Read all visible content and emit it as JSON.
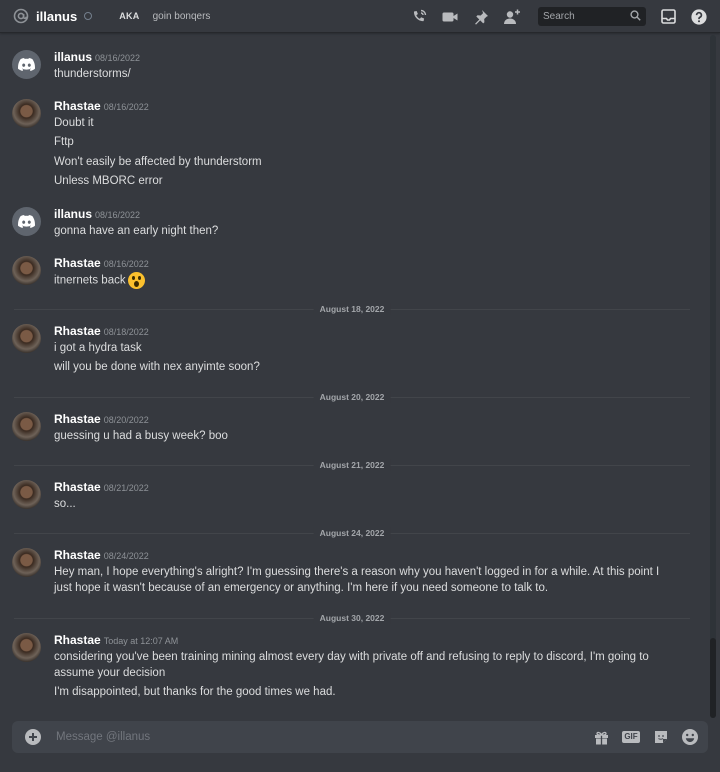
{
  "header": {
    "username": "illanus",
    "aka_badge": "AKA",
    "aka_value": "goin bonqers",
    "search_placeholder": "Search",
    "icons": [
      "at-icon",
      "call-icon",
      "video-icon",
      "pin-icon",
      "add-friend-icon",
      "search-icon",
      "inbox-icon",
      "help-icon"
    ]
  },
  "messages": [
    {
      "author": "illanus",
      "timestamp": "08/16/2022",
      "avatar": "discord-default",
      "lines": [
        "thunderstorms/"
      ]
    },
    {
      "author": "Rhastae",
      "timestamp": "08/16/2022",
      "avatar": "photo",
      "lines": [
        "Doubt it",
        "Fttp",
        "Won't easily be affected by thunderstorm",
        "Unless MBORC error"
      ]
    },
    {
      "author": "illanus",
      "timestamp": "08/16/2022",
      "avatar": "discord-default",
      "lines": [
        "gonna have an early night then?"
      ]
    },
    {
      "author": "Rhastae",
      "timestamp": "08/16/2022",
      "avatar": "photo",
      "lines": [
        "itnernets back"
      ],
      "emoji": "astonished-face"
    },
    {
      "author": "Rhastae",
      "timestamp": "08/18/2022",
      "avatar": "photo",
      "lines": [
        "i got a hydra task",
        "will you be done with nex anyimte soon?"
      ]
    },
    {
      "author": "Rhastae",
      "timestamp": "08/20/2022",
      "avatar": "photo",
      "lines": [
        "guessing u had a busy week? boo"
      ]
    },
    {
      "author": "Rhastae",
      "timestamp": "08/21/2022",
      "avatar": "photo",
      "lines": [
        "so..."
      ]
    },
    {
      "author": "Rhastae",
      "timestamp": "08/24/2022",
      "avatar": "photo",
      "lines": [
        "Hey man, I hope everything's alright? I'm guessing there's a reason why you haven't logged in for a while. At this point I",
        "just hope it wasn't because of an emergency or anything. I'm here if you need someone to talk to."
      ]
    },
    {
      "author": "Rhastae",
      "timestamp": "Today at 12:07 AM",
      "avatar": "photo",
      "lines": [
        "considering you've been training mining almost every day with private off and refusing to reply to discord, I'm going to",
        "assume your decision",
        "I'm disappointed, but thanks for the good times we had."
      ]
    }
  ],
  "date_dividers": [
    "August 18, 2022",
    "August 20, 2022",
    "August 21, 2022",
    "August 24, 2022",
    "August 30, 2022"
  ],
  "composer": {
    "placeholder": "Message @illanus",
    "gif_label": "GIF",
    "icons": [
      "add-attachment-icon",
      "gift-icon",
      "gif-icon",
      "sticker-icon",
      "emoji-icon"
    ]
  },
  "colors": {
    "background": "#36393f",
    "input_background": "#40444b",
    "search_background": "#202225",
    "author": "#ffffff",
    "timestamp": "#8e9297",
    "text": "#dcddde"
  }
}
